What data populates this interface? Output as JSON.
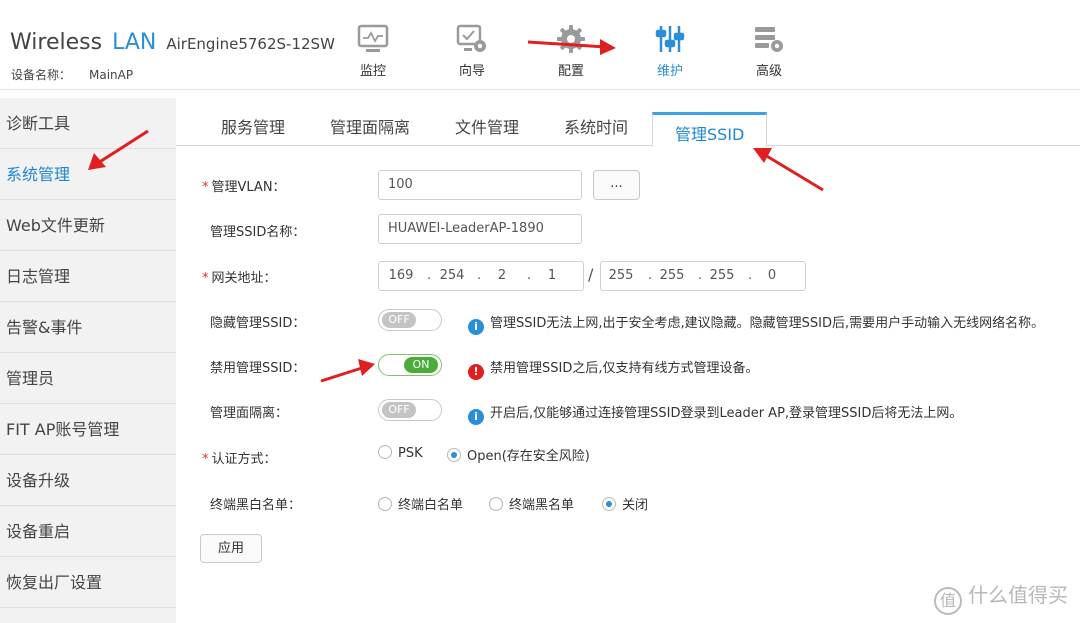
{
  "header": {
    "brand_wireless": "Wireless",
    "brand_lan": "LAN",
    "model": "AirEngine5762S-12SW",
    "device_label": "设备名称：",
    "device_value": "MainAP",
    "nav": [
      {
        "label": "监控",
        "icon": "monitor-icon"
      },
      {
        "label": "向导",
        "icon": "wizard-icon"
      },
      {
        "label": "配置",
        "icon": "gear-icon"
      },
      {
        "label": "维护",
        "icon": "sliders-icon",
        "active": true
      },
      {
        "label": "高级",
        "icon": "advanced-icon"
      }
    ]
  },
  "sidebar": {
    "items": [
      {
        "label": "诊断工具"
      },
      {
        "label": "系统管理",
        "active": true
      },
      {
        "label": "Web文件更新"
      },
      {
        "label": "日志管理"
      },
      {
        "label": "告警&事件"
      },
      {
        "label": "管理员"
      },
      {
        "label": "FIT AP账号管理"
      },
      {
        "label": "设备升级"
      },
      {
        "label": "设备重启"
      },
      {
        "label": "恢复出厂设置"
      }
    ]
  },
  "tabs": [
    {
      "label": "服务管理"
    },
    {
      "label": "管理面隔离"
    },
    {
      "label": "文件管理"
    },
    {
      "label": "系统时间"
    },
    {
      "label": "管理SSID",
      "active": true
    }
  ],
  "form": {
    "required_mark": "*",
    "vlan_label": "管理VLAN：",
    "vlan_value": "100",
    "vlan_button": "...",
    "ssid_name_label": "管理SSID名称：",
    "ssid_name_value": "HUAWEI-LeaderAP-1890",
    "gateway_label": "网关地址：",
    "ip_octets": [
      "169",
      "254",
      "2",
      "1"
    ],
    "mask_octets": [
      "255",
      "255",
      "255",
      "0"
    ],
    "ip_dot": ".",
    "slash": "/",
    "hide_ssid_label": "隐藏管理SSID：",
    "hide_ssid_state": "OFF",
    "hide_ssid_hint": "管理SSID无法上网,出于安全考虑,建议隐藏。隐藏管理SSID后,需要用户手动输入无线网络名称。",
    "disable_ssid_label": "禁用管理SSID：",
    "disable_ssid_state": "ON",
    "disable_ssid_hint": "禁用管理SSID之后,仅支持有线方式管理设备。",
    "isolation_label": "管理面隔离：",
    "isolation_state": "OFF",
    "isolation_hint": "开启后,仅能够通过连接管理SSID登录到Leader AP,登录管理SSID后将无法上网。",
    "info_glyph": "i",
    "warn_glyph": "!",
    "auth_label": "认证方式：",
    "auth_options": [
      {
        "label": "PSK",
        "selected": false
      },
      {
        "label": "Open(存在安全风险)",
        "selected": true
      }
    ],
    "list_label": "终端黑白名单：",
    "list_options": [
      {
        "label": "终端白名单",
        "selected": false
      },
      {
        "label": "终端黑名单",
        "selected": false
      },
      {
        "label": "关闭",
        "selected": true
      }
    ],
    "apply_button": "应用"
  },
  "colors": {
    "accent": "#2a8fd8",
    "toggle_on": "#4bac3a",
    "annotation_arrow": "#e02020"
  },
  "watermark": {
    "glyph": "值",
    "text": "什么值得买"
  }
}
